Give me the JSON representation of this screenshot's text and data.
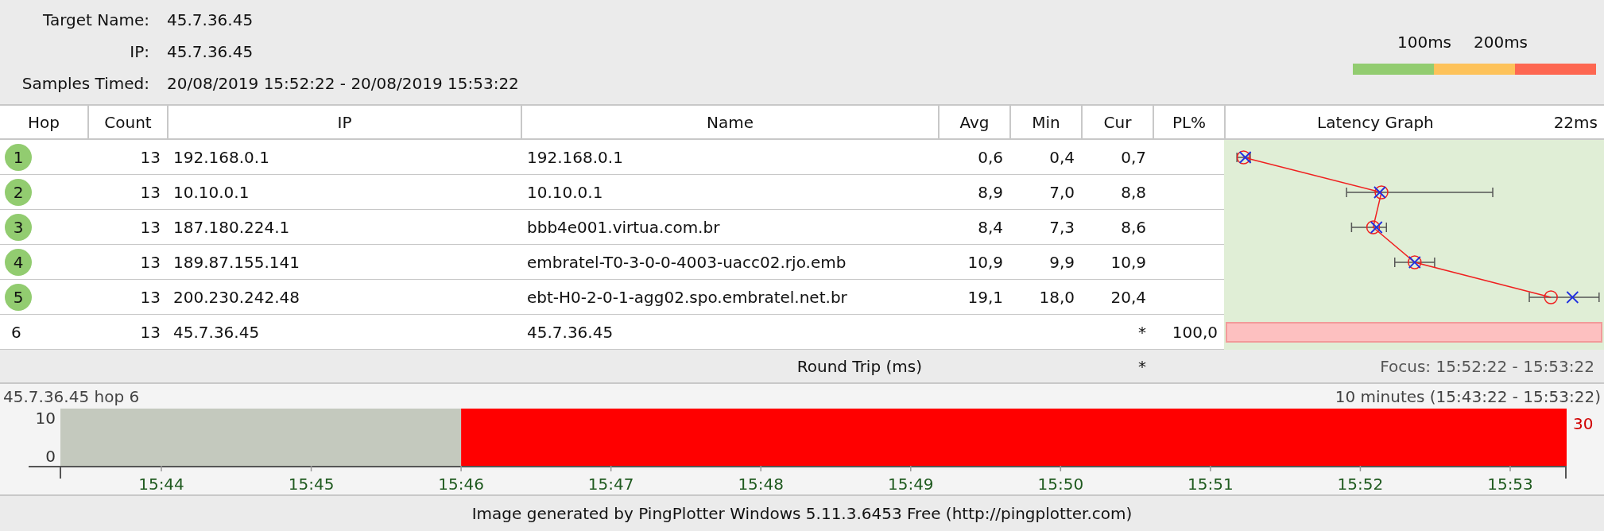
{
  "summary": [
    {
      "label": "Target Name:",
      "value": "45.7.36.45"
    },
    {
      "label": "IP:",
      "value": "45.7.36.45"
    },
    {
      "label": "Samples Timed:",
      "value": "20/08/2019 15:52:22 - 20/08/2019 15:53:22"
    }
  ],
  "legend": {
    "labels": [
      "100ms",
      "200ms"
    ]
  },
  "columns": [
    "Hop",
    "Count",
    "IP",
    "Name",
    "Avg",
    "Min",
    "Cur",
    "PL%",
    "Latency Graph"
  ],
  "graph_scale": "22ms",
  "rows": [
    {
      "hop": "1",
      "count": "13",
      "ip": "192.168.0.1",
      "name": "192.168.0.1",
      "avg": "0,6",
      "min": "0,4",
      "cur": "0,7",
      "lost": false
    },
    {
      "hop": "2",
      "count": "13",
      "ip": "10.10.0.1",
      "name": "10.10.0.1",
      "avg": "8,9",
      "min": "7,0",
      "cur": "8,8",
      "lost": false
    },
    {
      "hop": "3",
      "count": "13",
      "ip": "187.180.224.1",
      "name": "bbb4e001.virtua.com.br",
      "avg": "8,4",
      "min": "7,3",
      "cur": "8,6",
      "lost": false
    },
    {
      "hop": "4",
      "count": "13",
      "ip": "189.87.155.141",
      "name": "embratel-T0-3-0-0-4003-uacc02.rjo.emb",
      "avg": "10,9",
      "min": "9,9",
      "cur": "10,9",
      "lost": false
    },
    {
      "hop": "5",
      "count": "13",
      "ip": "200.230.242.48",
      "name": "ebt-H0-2-0-1-agg02.spo.embratel.net.br",
      "avg": "19,1",
      "min": "18,0",
      "cur": "20,4",
      "lost": false
    },
    {
      "hop": "6",
      "count": "13",
      "ip": "45.7.36.45",
      "name": "45.7.36.45",
      "cur": "*",
      "pl": "100,0",
      "lost": true
    }
  ],
  "round_trip": {
    "label": "Round Trip (ms)",
    "cur": "*",
    "focus": "Focus: 15:52:22 - 15:53:22"
  },
  "history": {
    "title": "45.7.36.45 hop 6",
    "range": "10 minutes (15:43:22 - 15:53:22)",
    "y_labels": [
      "10",
      "0"
    ],
    "max_label": "30",
    "x_labels": [
      "15:44",
      "15:45",
      "15:46",
      "15:47",
      "15:48",
      "15:49",
      "15:50",
      "15:51",
      "15:52",
      "15:53"
    ]
  },
  "footer": "Image generated by PingPlotter Windows 5.11.3.6453 Free (http://pingplotter.com)"
}
